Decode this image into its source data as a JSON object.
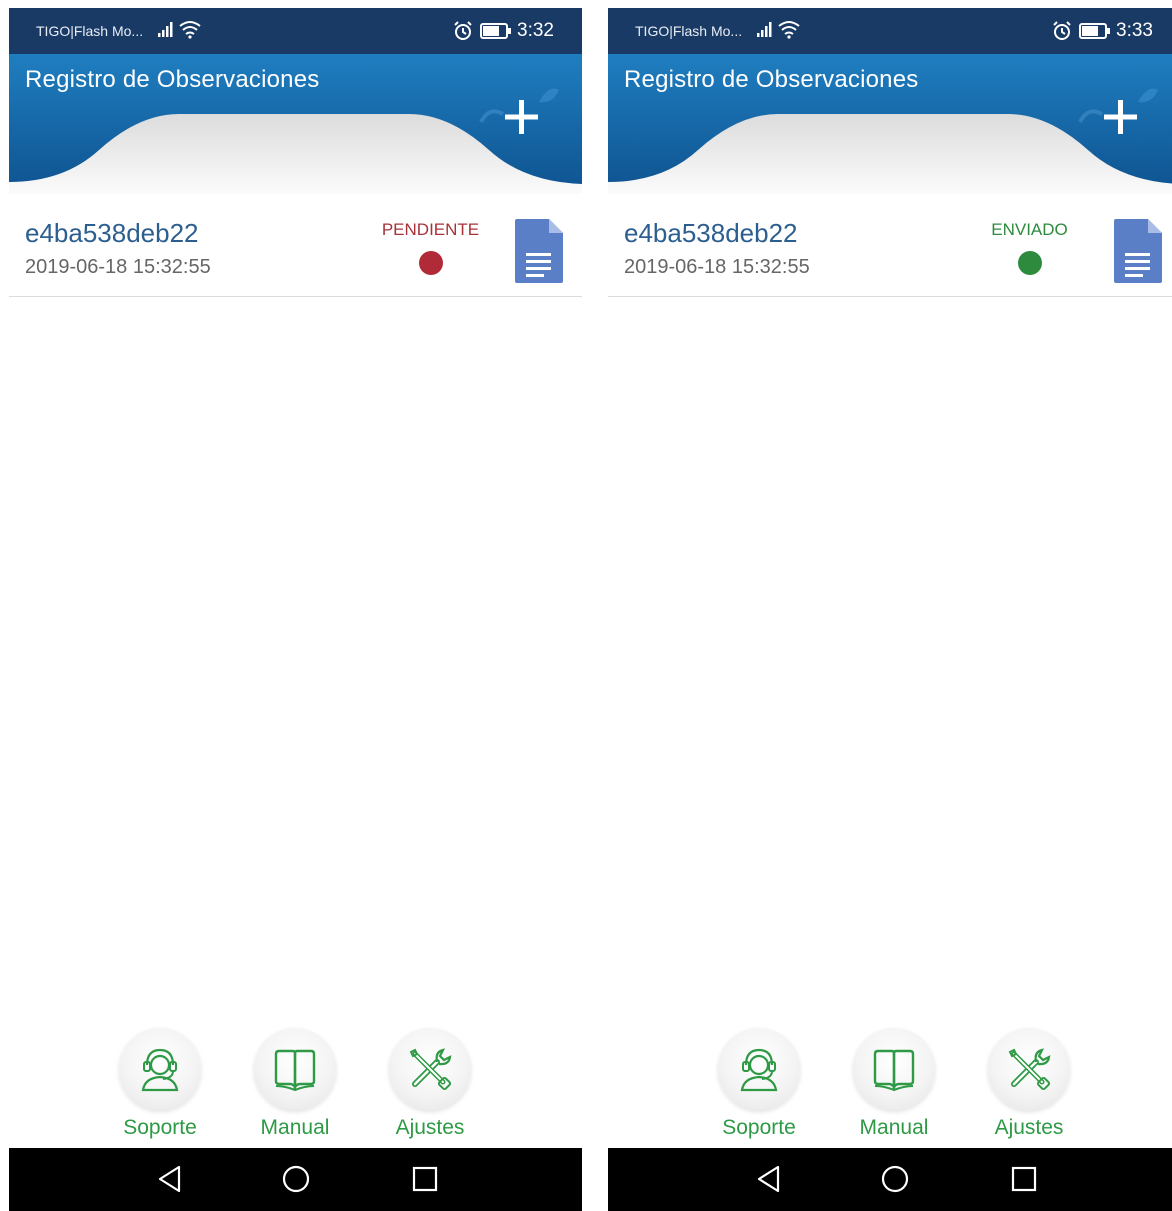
{
  "screens": [
    {
      "status_bar": {
        "carrier": "TIGO|Flash Mo...",
        "time": "3:32"
      },
      "header": {
        "title": "Registro de Observaciones"
      },
      "records": [
        {
          "id": "e4ba538deb22",
          "date": "2019-06-18 15:32:55",
          "status": "PENDIENTE",
          "status_color": "#a8323a",
          "dot_color": "#b02a37"
        }
      ],
      "bottom_nav": {
        "support_label": "Soporte",
        "manual_label": "Manual",
        "settings_label": "Ajustes"
      }
    },
    {
      "status_bar": {
        "carrier": "TIGO|Flash Mo...",
        "time": "3:33"
      },
      "header": {
        "title": "Registro de Observaciones"
      },
      "records": [
        {
          "id": "e4ba538deb22",
          "date": "2019-06-18 15:32:55",
          "status": "ENVIADO",
          "status_color": "#2e8b3e",
          "dot_color": "#2e8b3e"
        }
      ],
      "bottom_nav": {
        "support_label": "Soporte",
        "manual_label": "Manual",
        "settings_label": "Ajustes"
      }
    }
  ],
  "colors": {
    "status_bar": "#1a3a66",
    "header_blue": "#1668a8",
    "accent_green": "#2e9a45",
    "record_id": "#2c5e8f",
    "doc_icon": "#5b7fc7"
  },
  "icons": {
    "add": "plus-icon",
    "document": "document-icon",
    "support": "headset-icon",
    "manual": "book-icon",
    "settings": "tools-icon"
  }
}
